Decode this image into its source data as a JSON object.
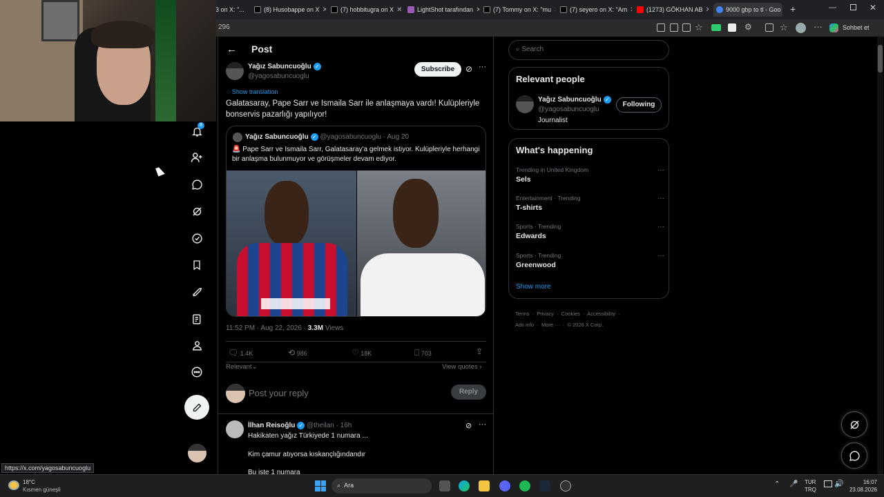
{
  "browser": {
    "tabs": [
      {
        "label": "3 on X: \"...",
        "color": "#555"
      },
      {
        "label": "(8) Husobappe on X",
        "color": "#000"
      },
      {
        "label": "(7) hobbitugra on X",
        "color": "#000"
      },
      {
        "label": "LightShot tarafından",
        "color": "#9b59b6"
      },
      {
        "label": "(7) Tommy on X: \"mu",
        "color": "#000"
      },
      {
        "label": "(7) seyero on X: \"Am",
        "color": "#000"
      },
      {
        "label": "(1273) GÖKHAN AB",
        "color": "#ff0000"
      },
      {
        "label": "9000 gbp to tl - Goo",
        "color": "#4285f4"
      }
    ],
    "address_fragment": "296",
    "chat_label": "Sohbet et",
    "status_url": "https://x.com/yagosabuncuoglu"
  },
  "post_header": {
    "title": "Post"
  },
  "tweet": {
    "author_name": "Yağız Sabuncuoğlu",
    "handle": "@yagosabuncuoglu",
    "subscribe_label": "Subscribe",
    "show_translation": "Show translation",
    "text": "Galatasaray, Pape Sarr ve Ismaila Sarr ile anlaşmaya vardı! Kulüpleriyle bonservis pazarlığı yapılıyor!",
    "quote": {
      "author_name": "Yağız Sabuncuoğlu",
      "handle": "@yagosabuncuoglu",
      "date": "· Aug 20",
      "text": "🚨 Pape Sarr ve Ismaila Sarr, Galatasaray'a gelmek istiyor. Kulüpleriyle herhangi bir anlaşma bulunmuyor ve görüşmeler devam ediyor."
    },
    "timestamp": "11:52 PM · Aug 22, 2026 ·",
    "views_count": "3.3M",
    "views_label": "Views",
    "replies": "1.4K",
    "reposts": "986",
    "likes": "18K",
    "bookmarks": "703",
    "sort_label": "Relevant",
    "view_quotes": "View quotes"
  },
  "reply_box": {
    "placeholder": "Post your reply",
    "reply_label": "Reply"
  },
  "reply": {
    "author_name": "İlhan Reisoğlu",
    "handle": "@theilan",
    "time": "· 16h",
    "line1": "Hakikaten yağız Türkiyede 1 numara ...",
    "line2": "Kim çamur atıyorsa kıskançlığındandır",
    "line3": "Bu işte 1 numara"
  },
  "search": {
    "placeholder": "Search"
  },
  "relevant_people": {
    "title": "Relevant people",
    "name": "Yağız Sabuncuoğlu",
    "handle": "@yagosabuncuoglu",
    "bio": "Journalist",
    "following_label": "Following"
  },
  "whats_happening": {
    "title": "What's happening",
    "items": [
      {
        "context": "Trending in United Kingdom",
        "topic": "Sels"
      },
      {
        "context": "Entertainment · Trending",
        "topic": "T-shirts"
      },
      {
        "context": "Sports · Trending",
        "topic": "Edwards"
      },
      {
        "context": "Sports · Trending",
        "topic": "Greenwood"
      }
    ],
    "show_more": "Show more"
  },
  "footer": {
    "terms": "Terms",
    "privacy": "Privacy",
    "cookies": "Cookies",
    "accessibility": "Accessibility",
    "ads": "Ads info",
    "more": "More ···",
    "copyright": "© 2026 X Corp."
  },
  "notification_badge": "8",
  "taskbar": {
    "weather_temp": "18°C",
    "weather_desc": "Kısmen güneşli",
    "search_label": "Ara",
    "lang_top": "TUR",
    "lang_bottom": "TRQ",
    "time": "16:07",
    "date": "23.08.2026"
  },
  "colors": {
    "accent": "#1d9bf0",
    "background": "#000000",
    "border": "#2f3336",
    "muted": "#71767b"
  }
}
